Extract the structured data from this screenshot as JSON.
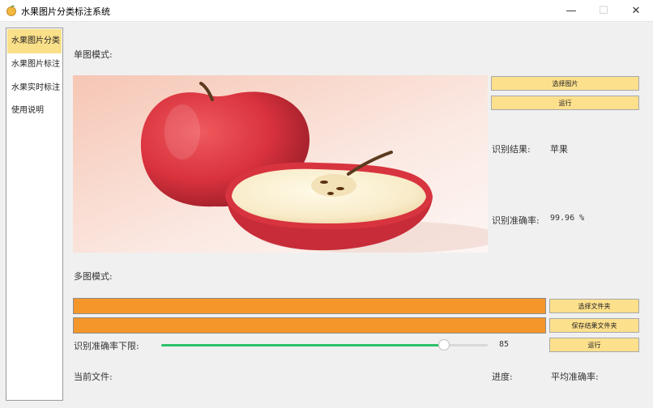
{
  "window": {
    "title": "水果图片分类标注系统",
    "minimize": "—",
    "maximize": "☐",
    "close": "✕"
  },
  "sidebar": {
    "items": [
      {
        "label": "水果图片分类",
        "active": true
      },
      {
        "label": "水果图片标注",
        "active": false
      },
      {
        "label": "水果实时标注",
        "active": false
      },
      {
        "label": "使用说明",
        "active": false
      }
    ]
  },
  "single": {
    "section_label": "单图模式:",
    "select_button": "选择图片",
    "run_button": "运行",
    "result_label": "识别结果:",
    "result_value": "苹果",
    "accuracy_label": "识别准确率:",
    "accuracy_value": "99.96 %"
  },
  "multi": {
    "section_label": "多图模式:",
    "select_folder_button": "选择文件夹",
    "save_folder_button": "保存结果文件夹",
    "threshold_label": "识别准确率下限:",
    "threshold_value": "85",
    "threshold_fraction": 0.865,
    "run_button": "运行",
    "current_file_label": "当前文件:",
    "progress_label": "进度:",
    "avg_accuracy_label": "平均准确率:"
  },
  "colors": {
    "accent_yellow": "#fde08c",
    "active_tab": "#fbe08a",
    "orange_bar": "#f5962a",
    "slider_fill": "#2ec16a"
  },
  "icons": {
    "app": "fruit-icon",
    "photo": "apple-photo"
  }
}
